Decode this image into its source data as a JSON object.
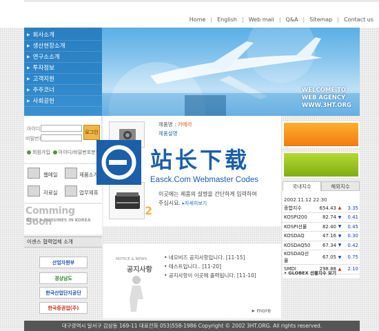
{
  "nav": {
    "items": [
      "Home",
      "English",
      "Web mail",
      "Q&A",
      "Sitemap",
      "Contact us"
    ]
  },
  "menu": {
    "items": [
      "회사소개",
      "생산현장소개",
      "연구소소개",
      "투자정보",
      "고객지원",
      "주주코너",
      "사회공헌"
    ]
  },
  "banner": {
    "welcome_line1": "WELCOME TO",
    "welcome_line2": "WEB AGENCY",
    "welcome_line3": "WWW.3HT.ORG"
  },
  "login": {
    "id_label": "아이디",
    "pw_label": "비밀번호",
    "button": "로그인",
    "join": "회원가입",
    "find": "아이디/비밀번호분실"
  },
  "quick": {
    "webhard": "웹메일",
    "product_info": "제품소개",
    "data_room": "자료실",
    "biz_inquiry": "업무제휴"
  },
  "coming": {
    "title": "Comming Soon",
    "subtitle": "BEST E-BUSSINES IN KOREA"
  },
  "partners": {
    "title": "이센스 협력업체 소개",
    "items": [
      "산업자원부",
      "경상남도",
      "한국산업단지공단",
      "한국증권업(주)"
    ]
  },
  "product": {
    "name_label": "제품명 : ",
    "name_value": "카메라",
    "desc_title": "제품설명",
    "desc": "이곳에는 제품의 설명을 간단하게 입력하여 주십시요.",
    "more": "자세히보기",
    "page_num": "2"
  },
  "notice": {
    "title_en": "NOTICE & NEWS",
    "title": "공지사항",
    "items": [
      "네오비즈 공지사항입니다. [11-15]",
      "테스트입니다.. [11-20]",
      "공지사항이 이곳에 출력됩니다. [11-10]"
    ],
    "more": "more"
  },
  "stock": {
    "tab1": "국내지수",
    "tab2": "해외지수",
    "date": "2002.11.12 22:30",
    "rows": [
      {
        "name": "종합지수",
        "value": "654.43",
        "dir": "up",
        "change": "3.35"
      },
      {
        "name": "KOSPI200",
        "value": "82.74",
        "dir": "down",
        "change": "0.41"
      },
      {
        "name": "KOSPI선물",
        "value": "82.40",
        "dir": "down",
        "change": "0.45"
      },
      {
        "name": "KOSDAQ",
        "value": "47.16",
        "dir": "down",
        "change": "0.30"
      },
      {
        "name": "KOSDAQ50",
        "value": "67.34",
        "dir": "down",
        "change": "0.42"
      },
      {
        "name": "KOSDAQ선물",
        "value": "67.05",
        "dir": "down",
        "change": "0.75"
      },
      {
        "name": "SMDI",
        "value": "298.88",
        "dir": "up",
        "change": "2.10"
      }
    ],
    "globex": "• GLOBEX 선물지수 보기"
  },
  "footer": {
    "text": "대구광역시 달서구 감삼동 169-11   대표전화 053)558-1986    Copyright © 2002 3HT.ORG. All rights reserved."
  },
  "watermark": {
    "cn": "站长下载",
    "en": "Easck.Com Webmaster Codes"
  },
  "colors": {
    "menu_blue": "#2a7fc0",
    "accent_orange": "#f07b10",
    "accent_green": "#80ad14",
    "stock_up": "#d12121",
    "stock_down": "#1c3fae",
    "footer_bg": "#555555"
  }
}
